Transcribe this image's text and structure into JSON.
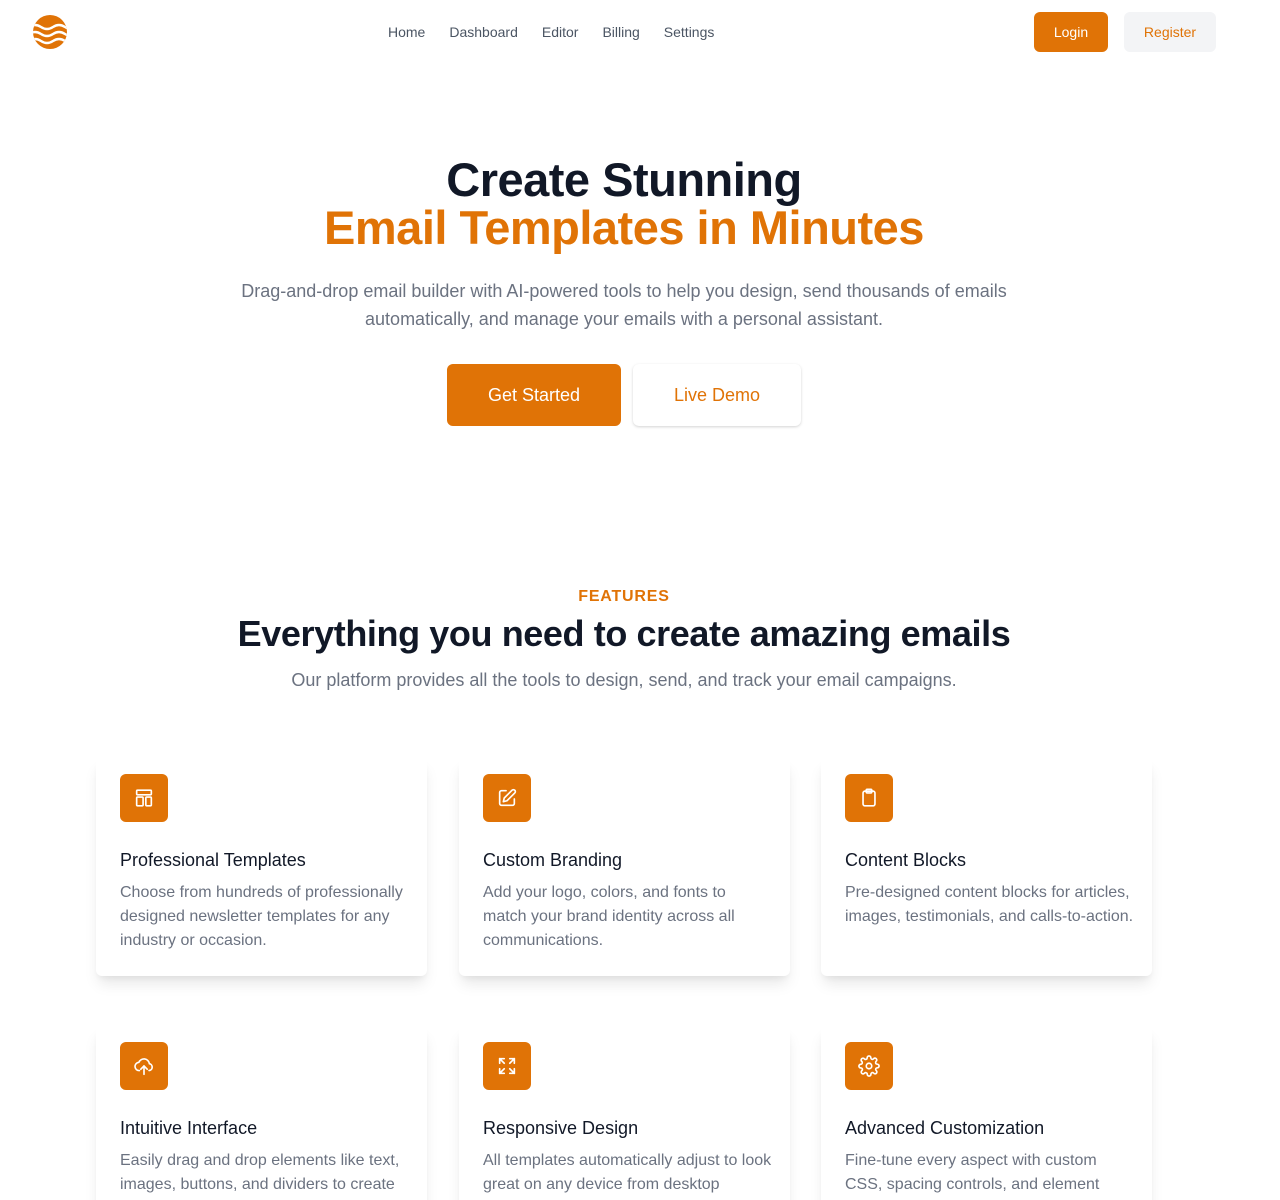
{
  "header": {
    "logo_icon": "wave-sun-logo",
    "nav": [
      "Home",
      "Dashboard",
      "Editor",
      "Billing",
      "Settings"
    ],
    "login_label": "Login",
    "register_label": "Register"
  },
  "hero": {
    "title_line1": "Create Stunning",
    "title_line2": "Email Templates in Minutes",
    "subtitle": "Drag-and-drop email builder with AI-powered tools to help you design, send thousands of emails automatically, and manage your emails with a personal assistant.",
    "primary_cta": "Get Started",
    "secondary_cta": "Live Demo"
  },
  "features": {
    "eyebrow": "FEATURES",
    "title": "Everything you need to create amazing emails",
    "subtitle": "Our platform provides all the tools to design, send, and track your email campaigns.",
    "cards": [
      {
        "icon": "layout-template-icon",
        "title": "Professional Templates",
        "description": "Choose from hundreds of professionally designed newsletter templates for any industry or occasion."
      },
      {
        "icon": "pencil-square-icon",
        "title": "Custom Branding",
        "description": "Add your logo, colors, and fonts to match your brand identity across all communications."
      },
      {
        "icon": "clipboard-icon",
        "title": "Content Blocks",
        "description": "Pre-designed content blocks for articles, images, testimonials, and calls-to-action."
      },
      {
        "icon": "cloud-upload-icon",
        "title": "Intuitive Interface",
        "description": "Easily drag and drop elements like text, images, buttons, and dividers to create"
      },
      {
        "icon": "expand-arrows-icon",
        "title": "Responsive Design",
        "description": "All templates automatically adjust to look great on any device from desktop"
      },
      {
        "icon": "gear-icon",
        "title": "Advanced Customization",
        "description": "Fine-tune every aspect with custom CSS, spacing controls, and element"
      }
    ]
  },
  "colors": {
    "accent": "#e07306",
    "heading": "#111827",
    "muted": "#6b7280",
    "button_secondary_bg": "#f3f4f6"
  }
}
